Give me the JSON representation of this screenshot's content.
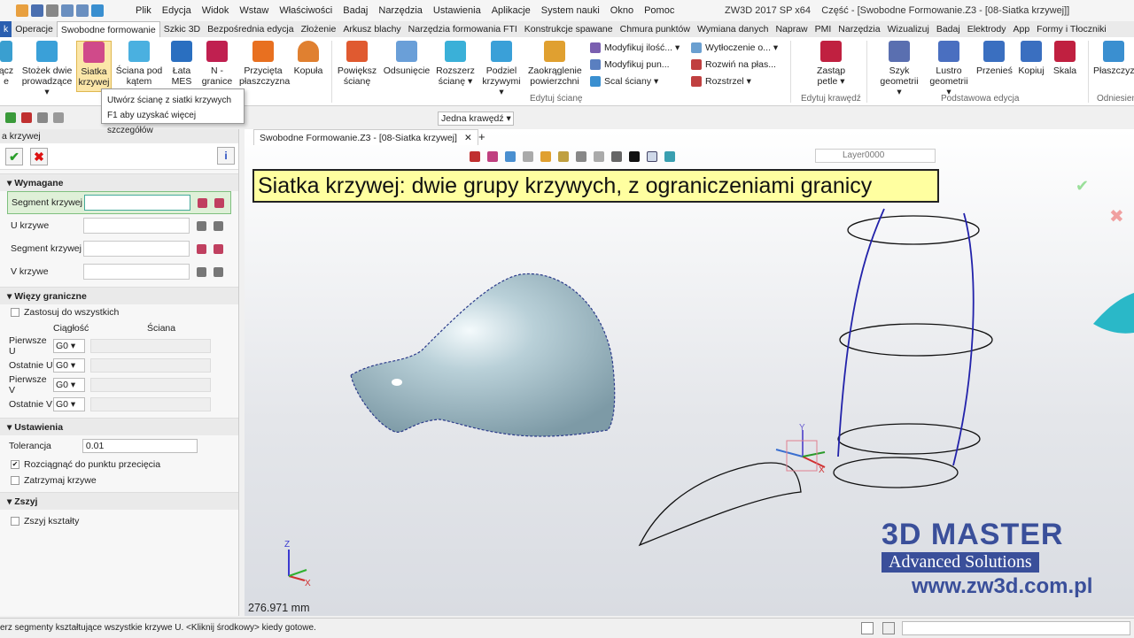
{
  "menubar": {
    "items": [
      "Plik",
      "Edycja",
      "Widok",
      "Wstaw",
      "Właściwości",
      "Badaj",
      "Narzędzia",
      "Ustawienia",
      "Aplikacje",
      "System nauki",
      "Okno",
      "Pomoc"
    ],
    "title": "ZW3D 2017 SP x64",
    "doc_title": "Część - [Swobodne Formowanie.Z3 - [08-Siatka krzywej]]"
  },
  "tabs": [
    "k",
    "Operacje",
    "Swobodne formowanie",
    "Szkic 3D",
    "Bezpośrednia edycja",
    "Złożenie",
    "Arkusz blachy",
    "Narzędzia formowania FTI",
    "Konstrukcje spawane",
    "Chmura punktów",
    "Wymiana danych",
    "Napraw",
    "PMI",
    "Narzędzia",
    "Wizualizuj",
    "Badaj",
    "Elektrody",
    "App",
    "Formy i Tłoczniki"
  ],
  "ribbon": {
    "b1": "ącz",
    "b1b": "e",
    "b2": "Stożek dwie",
    "b2b": "prowadzące ▾",
    "b3": "Siatka",
    "b3b": "krzywej",
    "b4": "Ściana pod",
    "b4b": "kątem",
    "b5": "Łata",
    "b5b": "MES",
    "b6": "N -",
    "b6b": "granice",
    "b7": "Przycięta",
    "b7b": "płaszczyzna",
    "b8": "Kopuła",
    "b9": "Powiększ",
    "b9b": "ścianę",
    "b10": "Odsunięcie",
    "b11": "Rozszerz",
    "b11b": "ścianę ▾",
    "b12": "Podziel",
    "b12b": "krzywymi ▾",
    "b13": "Zaokrąglenie",
    "b13b": "powierzchni",
    "s1": "Modyfikuj ilość... ▾",
    "s2": "Modyfikuj pun...",
    "s3": "Scal ściany ▾",
    "s4": "Wytłoczenie o... ▾",
    "s5": "Rozwiń na płas...",
    "s6": "Rozstrzel ▾",
    "b14": "Zastąp",
    "b14b": "petle ▾",
    "b15": "Szyk",
    "b15b": "geometrii ▾",
    "b16": "Lustro",
    "b16b": "geometrii ▾",
    "b17": "Przenieś",
    "b18": "Kopiuj",
    "b19": "Skala",
    "b20": "Płaszczyz",
    "g1": "Edytuj ścianę",
    "g2": "Edytuj krawędź",
    "g3": "Podstawowa edycja",
    "g4": "Odniesien"
  },
  "tooltip": {
    "line1": "Utwórz ścianę z siatki krzywych",
    "line2": "F1 aby uzyskać więcej szczegółów"
  },
  "edge_filter": "Jedna krawędź ▾",
  "panel": {
    "title": "a krzywej",
    "req": "Wymagane",
    "seg1": "Segment krzywej",
    "u": "U krzywe",
    "seg2": "Segment krzywej",
    "v": "V krzywe",
    "bounds": "Więzy graniczne",
    "apply_all": "Zastosuj do wszystkich",
    "col1": "Ciągłość",
    "col2": "Ściana",
    "first_u": "Pierwsze U",
    "last_u": "Ostatnie U",
    "first_v": "Pierwsze V",
    "last_v": "Ostatnie V",
    "g0": "G0 ▾",
    "settings": "Ustawienia",
    "tol_label": "Tolerancja",
    "tol_value": "0.01",
    "extend": "Rozciągnąć do punktu przecięcia",
    "keep": "Zatrzymaj krzywe",
    "stitch": "Zszyj",
    "stitch_shapes": "Zszyj kształty"
  },
  "doc": {
    "tab": "Swobodne Formowanie.Z3 - [08-Siatka krzywej]",
    "close": "✕",
    "add": "+",
    "layer": "Layer0000"
  },
  "caption": "Siatka krzywej: dwie grupy krzywych, z ograniczeniami granicy",
  "distance": "276.971 mm",
  "status": "erz segmenty kształtujące wszystkie krzywe U. <Kliknij środkowy> kiedy gotowe.",
  "logo": {
    "l1": "3D MASTER",
    "l2": "Advanced Solutions",
    "l3": "www.zw3d.com.pl"
  },
  "axes": {
    "x": "X",
    "y": "Y",
    "z": "Z"
  }
}
